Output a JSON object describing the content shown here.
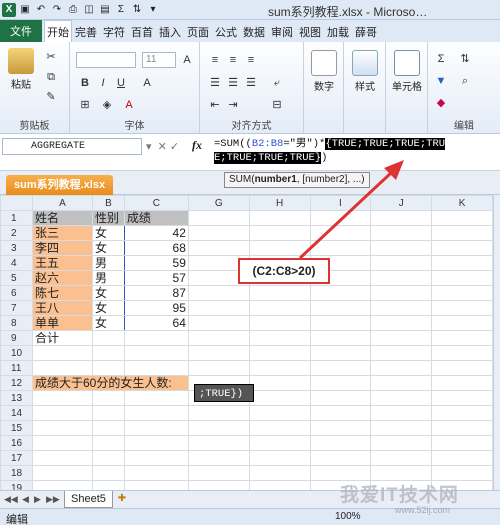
{
  "window": {
    "title": "sum系列教程.xlsx - Microso…"
  },
  "ribbon": {
    "file_tab": "文件",
    "tabs": [
      "开始",
      "完善",
      "字符",
      "百首",
      "插入",
      "页面",
      "公式",
      "数据",
      "审阅",
      "视图",
      "加载",
      "薛哥"
    ],
    "clipboard": {
      "paste": "粘贴",
      "label": "剪贴板"
    },
    "font": {
      "size": "11",
      "label": "字体"
    },
    "alignment": {
      "label": "对齐方式"
    },
    "number": {
      "button": "数字"
    },
    "styles": {
      "button": "样式"
    },
    "cells": {
      "button": "单元格"
    },
    "editing": {
      "label": "编辑"
    }
  },
  "formula_bar": {
    "name_box": "AGGREGATE",
    "fx": "fx",
    "formula_prefix": "=SUM((",
    "formula_ref": "B2:B8",
    "formula_mid": "=\"男\")*",
    "formula_selected": "{TRUE;TRUE;TRUE;TRUE;TRUE;TRUE;TRUE}",
    "formula_suffix": ")"
  },
  "tooltip": {
    "fn": "SUM(",
    "arg1": "number1",
    "rest": ", [number2], ...)"
  },
  "workbook_tab": "sum系列教程.xlsx",
  "columns": [
    "A",
    "B",
    "C",
    "G",
    "H",
    "I",
    "J",
    "K"
  ],
  "rows": [
    {
      "n": "1",
      "a": "姓名",
      "b": "性别",
      "c": "成绩"
    },
    {
      "n": "2",
      "a": "张三",
      "b": "女",
      "c": "42"
    },
    {
      "n": "3",
      "a": "李四",
      "b": "女",
      "c": "68"
    },
    {
      "n": "4",
      "a": "王五",
      "b": "男",
      "c": "59"
    },
    {
      "n": "5",
      "a": "赵六",
      "b": "男",
      "c": "57"
    },
    {
      "n": "6",
      "a": "陈七",
      "b": "女",
      "c": "87"
    },
    {
      "n": "7",
      "a": "王八",
      "b": "女",
      "c": "95"
    },
    {
      "n": "8",
      "a": "单单",
      "b": "女",
      "c": "64"
    },
    {
      "n": "9",
      "a": "合计",
      "b": "",
      "c": ""
    },
    {
      "n": "10",
      "a": "",
      "b": "",
      "c": ""
    },
    {
      "n": "11",
      "a": "",
      "b": "",
      "c": ""
    },
    {
      "n": "12",
      "a": "成绩大于60分的女生人数:",
      "b": "",
      "c": ""
    },
    {
      "n": "13",
      "a": "",
      "b": "",
      "c": ""
    },
    {
      "n": "14",
      "a": "",
      "b": "",
      "c": ""
    },
    {
      "n": "15",
      "a": "",
      "b": "",
      "c": ""
    },
    {
      "n": "16",
      "a": "",
      "b": "",
      "c": ""
    },
    {
      "n": "17",
      "a": "",
      "b": "",
      "c": ""
    },
    {
      "n": "18",
      "a": "",
      "b": "",
      "c": ""
    },
    {
      "n": "19",
      "a": "",
      "b": "",
      "c": ""
    }
  ],
  "editing_cell": ";TRUE})",
  "annotation": "(C2:C8>20)",
  "sheet_tab": "Sheet5",
  "status": {
    "mode": "编辑",
    "zoom": "100%"
  },
  "watermark": {
    "main": "我爱IT技术网",
    "sub": "www.52ij.com"
  },
  "colors": {
    "excel_green": "#1f7244",
    "peach": "#fac090",
    "header_gray": "#c0c0c0",
    "annotation_red": "#dd3333"
  }
}
